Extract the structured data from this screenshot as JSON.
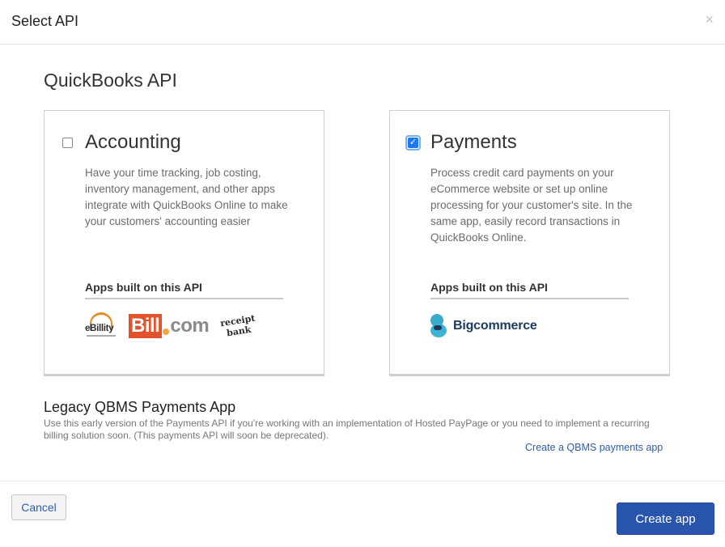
{
  "dialog": {
    "title": "Select API",
    "close_icon": "×"
  },
  "section": {
    "title": "QuickBooks API"
  },
  "cards": [
    {
      "title": "Accounting",
      "checked": false,
      "description": "Have your time tracking, job costing, inventory management, and other apps integrate with QuickBooks Online to make your customers' accounting easier",
      "apps_label": "Apps built on this API",
      "logos": [
        {
          "name": "ebillity-logo",
          "text": "eBillity"
        },
        {
          "name": "bill-com-logo",
          "text_bill": "Bill",
          "text_com": "com"
        },
        {
          "name": "receipt-bank-logo",
          "text_1": "receipt",
          "text_2": "bank"
        }
      ]
    },
    {
      "title": "Payments",
      "checked": true,
      "description": "Process credit card payments on your eCommerce website or set up online processing for your customer's site. In the same app, easily record transactions in QuickBooks Online.",
      "apps_label": "Apps built on this API",
      "logos": [
        {
          "name": "bigcommerce-logo",
          "text": "Bigcommerce"
        }
      ]
    }
  ],
  "legacy": {
    "title": "Legacy QBMS Payments App",
    "description": "Use this early version of the Payments API if you're working with an implementation of Hosted PayPage or you need to implement a recurring billing solution soon. (This payments API will soon be deprecated).",
    "link_label": "Create a QBMS payments app"
  },
  "footer": {
    "cancel_label": "Cancel",
    "create_label": "Create app"
  },
  "colors": {
    "primary_button": "#2a55ad",
    "link": "#2e5fa8",
    "checkbox_checked": "#1e79f0"
  }
}
